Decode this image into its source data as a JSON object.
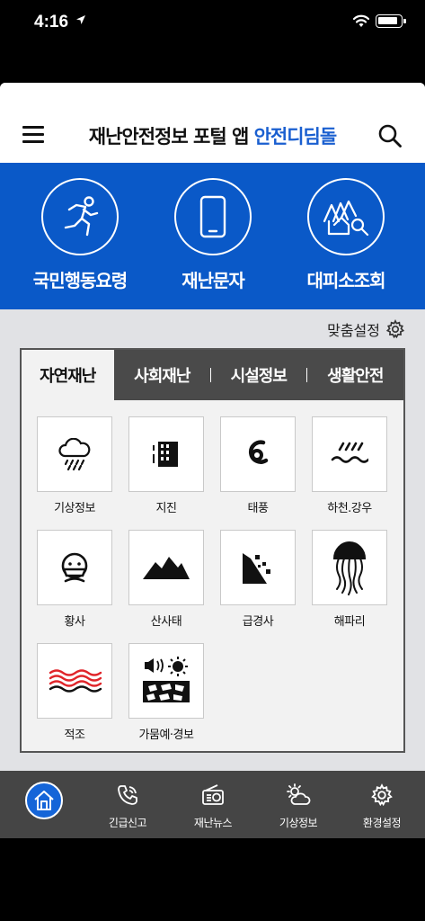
{
  "status_bar": {
    "time": "4:16"
  },
  "header": {
    "title_main": "재난안전정보 포털 앱 ",
    "title_accent": "안전디딤돌",
    "accent_color": "#1a5fd0"
  },
  "top_menu": {
    "background": "#0a59c8",
    "items": [
      {
        "label": "국민행동요령",
        "icon": "running-person-icon"
      },
      {
        "label": "재난문자",
        "icon": "smartphone-icon"
      },
      {
        "label": "대피소조회",
        "icon": "shelter-search-icon"
      }
    ]
  },
  "custom_settings": {
    "label": "맞춤설정",
    "icon": "gear-icon"
  },
  "tabs": [
    {
      "label": "자연재난",
      "active": true
    },
    {
      "label": "사회재난",
      "active": false
    },
    {
      "label": "시설정보",
      "active": false
    },
    {
      "label": "생활안전",
      "active": false
    }
  ],
  "grid_items": [
    {
      "label": "기상정보",
      "icon": "cloud-rain-icon"
    },
    {
      "label": "지진",
      "icon": "building-quake-icon"
    },
    {
      "label": "태풍",
      "icon": "typhoon-icon"
    },
    {
      "label": "하천.강우",
      "icon": "river-rain-icon"
    },
    {
      "label": "황사",
      "icon": "mask-face-icon"
    },
    {
      "label": "산사태",
      "icon": "mountain-icon"
    },
    {
      "label": "급경사",
      "icon": "steep-slope-icon"
    },
    {
      "label": "해파리",
      "icon": "jellyfish-icon"
    },
    {
      "label": "적조",
      "icon": "red-tide-icon"
    },
    {
      "label": "가뭄예·경보",
      "icon": "drought-alarm-icon"
    }
  ],
  "bottom_nav": [
    {
      "label": "",
      "icon": "home-icon",
      "active": true
    },
    {
      "label": "긴급신고",
      "icon": "phone-icon"
    },
    {
      "label": "재난뉴스",
      "icon": "radio-icon"
    },
    {
      "label": "기상정보",
      "icon": "weather-icon"
    },
    {
      "label": "환경설정",
      "icon": "settings-gear-icon"
    }
  ]
}
